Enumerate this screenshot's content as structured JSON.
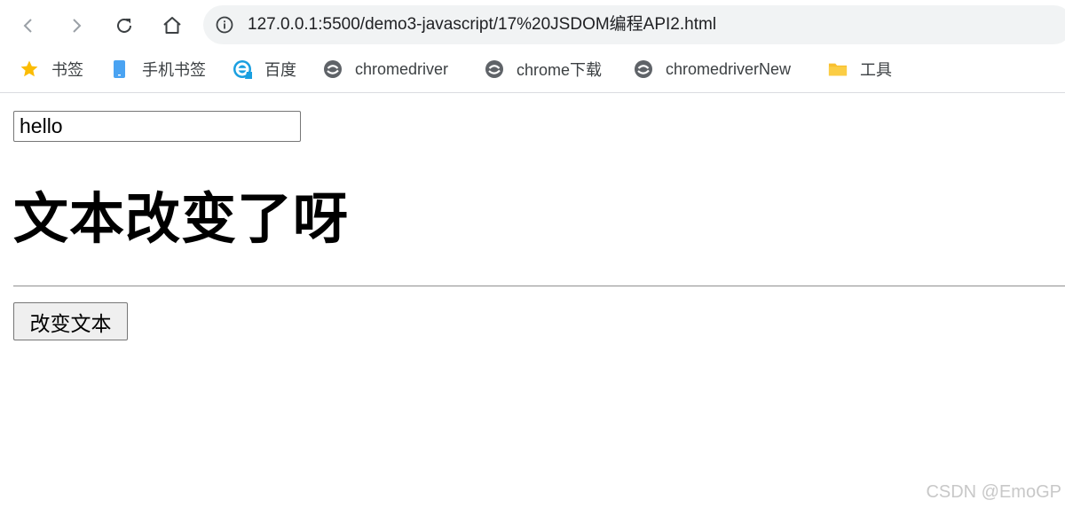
{
  "browser": {
    "url": "127.0.0.1:5500/demo3-javascript/17%20JSDOM编程API2.html",
    "bookmarks": [
      {
        "label": "书签",
        "icon": "star-icon"
      },
      {
        "label": "手机书签",
        "icon": "phone-icon"
      },
      {
        "label": "百度",
        "icon": "edge-icon"
      },
      {
        "label": "chromedriver",
        "icon": "site-icon"
      },
      {
        "label": "chrome下载",
        "icon": "site-icon"
      },
      {
        "label": "chromedriverNew",
        "icon": "site-icon"
      },
      {
        "label": "工具",
        "icon": "folder-icon"
      }
    ]
  },
  "page": {
    "input_value": "hello",
    "heading": "文本改变了呀",
    "button_label": "改变文本"
  },
  "watermark": "CSDN @EmoGP",
  "colors": {
    "star": "#fbbc04",
    "folder": "#f9c02f",
    "phone": "#4aa3f2",
    "site": "#5f6368"
  }
}
